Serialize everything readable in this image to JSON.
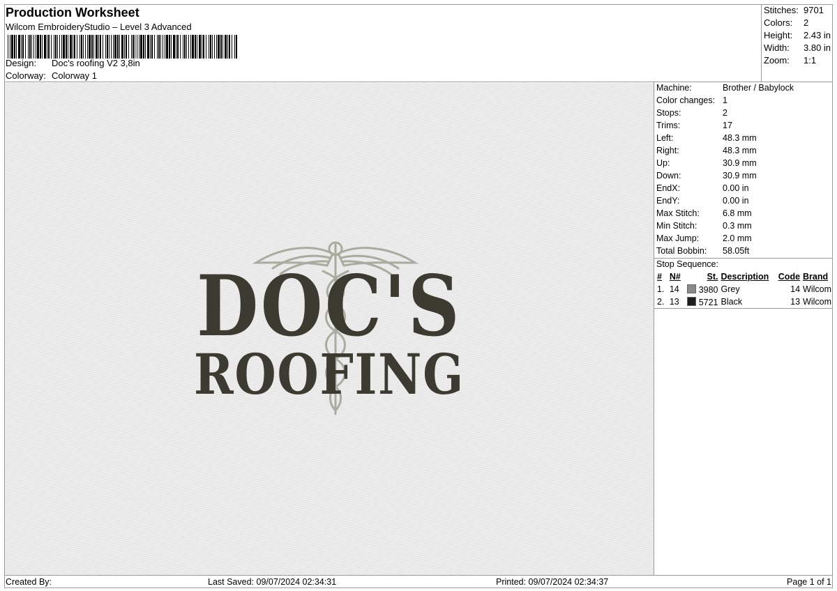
{
  "header": {
    "title": "Production Worksheet",
    "software": "Wilcom EmbroideryStudio – Level 3 Advanced",
    "design_label": "Design:",
    "design_value": "Doc's roofing V2 3,8in",
    "colorway_label": "Colorway:",
    "colorway_value": "Colorway 1"
  },
  "stats": [
    {
      "label": "Stitches:",
      "value": "9701"
    },
    {
      "label": "Colors:",
      "value": "2"
    },
    {
      "label": "Height:",
      "value": "2.43 in"
    },
    {
      "label": "Width:",
      "value": "3.80 in"
    },
    {
      "label": "Zoom:",
      "value": "1:1"
    }
  ],
  "machine_info": [
    {
      "label": "Machine:",
      "value": "Brother / Babylock"
    },
    {
      "label": "Color changes:",
      "value": "1"
    },
    {
      "label": "Stops:",
      "value": "2"
    },
    {
      "label": "Trims:",
      "value": "17"
    },
    {
      "label": "Left:",
      "value": "48.3 mm"
    },
    {
      "label": "Right:",
      "value": "48.3 mm"
    },
    {
      "label": "Up:",
      "value": "30.9 mm"
    },
    {
      "label": "Down:",
      "value": "30.9 mm"
    },
    {
      "label": "EndX:",
      "value": "0.00 in"
    },
    {
      "label": "EndY:",
      "value": "0.00 in"
    },
    {
      "label": "Max Stitch:",
      "value": "6.8 mm"
    },
    {
      "label": "Min Stitch:",
      "value": "0.3 mm"
    },
    {
      "label": "Max Jump:",
      "value": "2.0 mm"
    },
    {
      "label": "Total Bobbin:",
      "value": "58.05ft"
    }
  ],
  "stop_sequence": {
    "title": "Stop Sequence:",
    "headers": {
      "num": "#",
      "n": "N#",
      "st": "St.",
      "description": "Description",
      "code": "Code",
      "brand": "Brand"
    },
    "rows": [
      {
        "num": "1.",
        "n": "14",
        "color": "#8a8a8a",
        "st": "3980",
        "description": "Grey",
        "code": "14",
        "brand": "Wilcom"
      },
      {
        "num": "2.",
        "n": "13",
        "color": "#1e1e1e",
        "st": "5721",
        "description": "Black",
        "code": "13",
        "brand": "Wilcom"
      }
    ]
  },
  "design": {
    "line1": "DOC'S",
    "line2": "ROOFING",
    "text_color": "#3d3a32",
    "emblem_color": "#a9ab9e"
  },
  "footer": {
    "created": "Created By:",
    "last_saved": "Last Saved: 09/07/2024 02:34:31",
    "printed": "Printed: 09/07/2024 02:34:37",
    "page": "Page 1 of 1"
  }
}
